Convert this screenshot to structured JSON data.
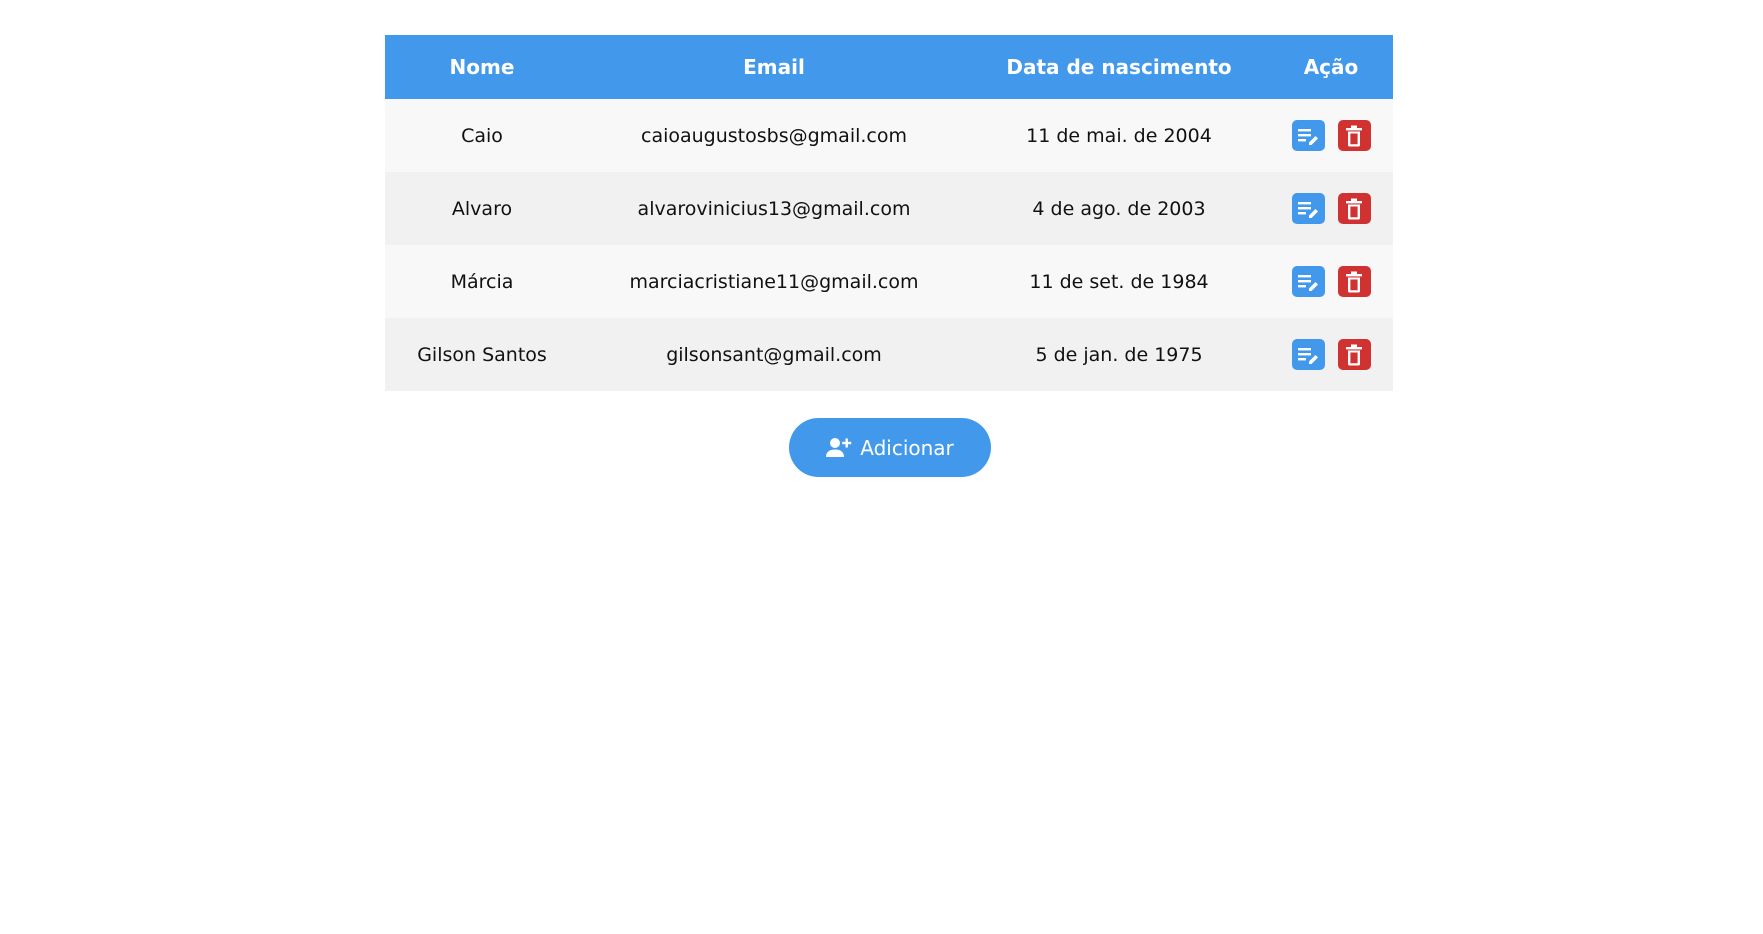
{
  "table": {
    "headers": {
      "nome": "Nome",
      "email": "Email",
      "data": "Data de nascimento",
      "acao": "Ação"
    },
    "rows": [
      {
        "nome": "Caio",
        "email": "caioaugustosbs@gmail.com",
        "data": "11 de mai. de 2004",
        "edit_icon": "edit-note-icon",
        "delete_icon": "trash-icon"
      },
      {
        "nome": "Alvaro",
        "email": "alvarovinicius13@gmail.com",
        "data": "4 de ago. de 2003",
        "edit_icon": "edit-note-icon",
        "delete_icon": "trash-icon"
      },
      {
        "nome": "Márcia",
        "email": "marciacristiane11@gmail.com",
        "data": "11 de set. de 1984",
        "edit_icon": "edit-note-icon",
        "delete_icon": "trash-icon"
      },
      {
        "nome": "Gilson Santos",
        "email": "gilsonsant@gmail.com",
        "data": "5 de jan. de 1975",
        "edit_icon": "edit-note-icon",
        "delete_icon": "trash-icon"
      }
    ]
  },
  "add_button": {
    "label": "Adicionar",
    "icon": "user-plus-icon"
  },
  "colors": {
    "primary": "#4299ec",
    "danger": "#d03131",
    "row_odd": "#f8f8f8",
    "row_even": "#f1f1f1"
  }
}
